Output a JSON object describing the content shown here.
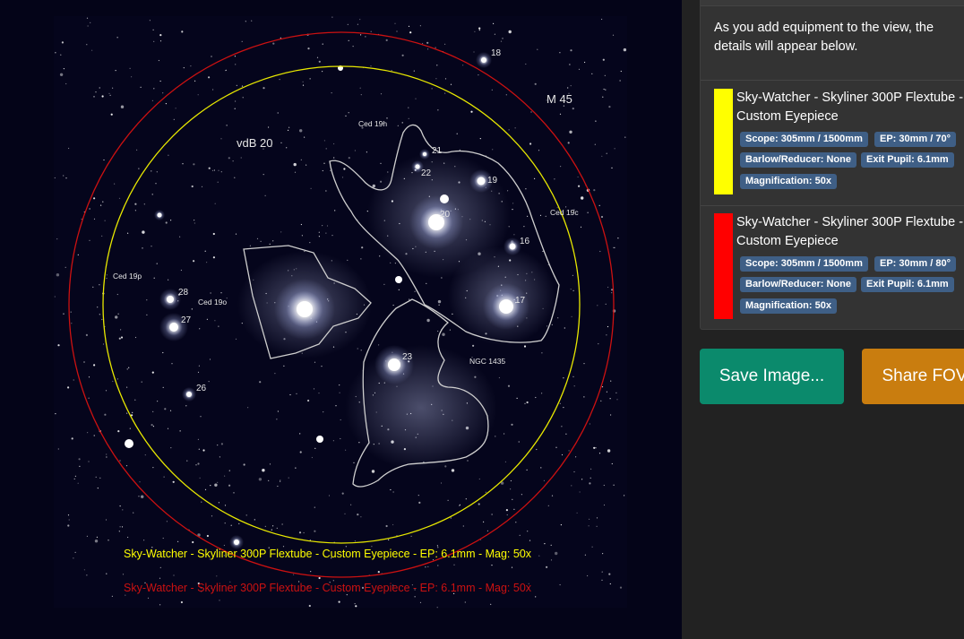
{
  "sky": {
    "labels": {
      "m45": "M 45",
      "vdb20": "vdB 20",
      "ced19h": "Ced 19h",
      "ced19c": "Ced 19c",
      "ced19p": "Ced 19p",
      "ced19o": "Ced 19o",
      "ngc1435": "NGC 1435",
      "n16": "16",
      "n17": "17",
      "n18": "18",
      "n19": "19",
      "n20": "20",
      "n21": "21",
      "n22": "22",
      "n23": "23",
      "n26": "26",
      "n27": "27",
      "n28": "28"
    },
    "captions": [
      {
        "text": "Sky-Watcher - Skyliner 300P Flextube - Custom Eyepiece - EP: 6.1mm - Mag: 50x",
        "color": "#ffff00"
      },
      {
        "text": "Sky-Watcher - Skyliner 300P Flextube - Custom Eyepiece - EP: 6.1mm - Mag: 50x",
        "color": "#cc1111"
      }
    ]
  },
  "panel": {
    "intro": "As you add equipment to the view, the details will appear below.",
    "entries": [
      {
        "color": "#ffff00",
        "title": "Sky-Watcher - Skyliner 300P Flextube -\nCustom Eyepiece",
        "scope": "Scope: 305mm / 1500mm",
        "ep": "EP: 30mm / 70°",
        "barlow": "Barlow/Reducer: None",
        "pupil": "Exit Pupil: 6.1mm",
        "mag": "Magnification: 50x"
      },
      {
        "color": "#ff0000",
        "title": "Sky-Watcher - Skyliner 300P Flextube -\nCustom Eyepiece",
        "scope": "Scope: 305mm / 1500mm",
        "ep": "EP: 30mm / 80°",
        "barlow": "Barlow/Reducer: None",
        "pupil": "Exit Pupil: 6.1mm",
        "mag": "Magnification: 50x"
      }
    ],
    "buttons": {
      "save": {
        "label": "Save Image...",
        "color": "#0b8a6c"
      },
      "share": {
        "label": "Share FOV",
        "color": "#c97d0f"
      }
    }
  }
}
